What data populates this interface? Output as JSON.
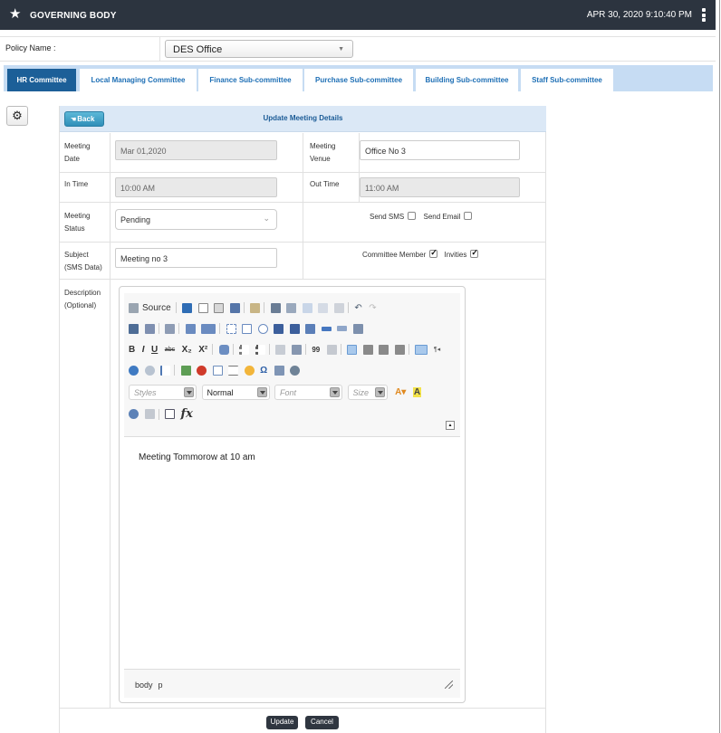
{
  "header": {
    "title": "GOVERNING BODY",
    "datetime": "APR 30, 2020  9:10:40 PM"
  },
  "policy": {
    "label": "Policy Name :",
    "selected": "DES Office"
  },
  "tabs": [
    {
      "label": "HR Committee",
      "active": true
    },
    {
      "label": "Local Managing Committee",
      "active": false
    },
    {
      "label": "Finance Sub-committee",
      "active": false
    },
    {
      "label": "Purchase Sub-committee",
      "active": false
    },
    {
      "label": "Building Sub-committee",
      "active": false
    },
    {
      "label": "Staff Sub-committee",
      "active": false
    }
  ],
  "form": {
    "back_label": "Back",
    "title": "Update Meeting Details",
    "meeting_date": {
      "label_line1": "Meeting",
      "label_line2": "Date",
      "value": "Mar 01,2020"
    },
    "meeting_venue": {
      "label_line1": "Meeting",
      "label_line2": "Venue",
      "value": "Office No 3"
    },
    "in_time": {
      "label": "In Time",
      "value": "10:00 AM"
    },
    "out_time": {
      "label": "Out Time",
      "value": "11:00 AM"
    },
    "meeting_status": {
      "label_line1": "Meeting",
      "label_line2": "Status",
      "value": "Pending"
    },
    "send_sms": {
      "label": "Send SMS",
      "checked": false
    },
    "send_email": {
      "label": "Send Email",
      "checked": false
    },
    "subject": {
      "label_line1": "Subject",
      "label_line2": "(SMS Data)",
      "value": "Meeting no 3"
    },
    "committee_member": {
      "label": "Committee Member",
      "checked": true
    },
    "invities": {
      "label": "Invities",
      "checked": true
    },
    "description": {
      "label_line1": "Description",
      "label_line2": "(Optional)"
    }
  },
  "editor": {
    "source_label": "Source",
    "styles_placeholder": "Styles",
    "format_value": "Normal",
    "font_placeholder": "Font",
    "size_placeholder": "Size",
    "fx_label": "fx",
    "bold_label": "B",
    "italic_label": "I",
    "underline_label": "U",
    "strike_label": "abc",
    "sub_label": "X₂",
    "sup_label": "X²",
    "content": "Meeting Tommorow at 10 am",
    "path": [
      "body",
      "p"
    ]
  },
  "actions": {
    "update_label": "Update",
    "cancel_label": "Cancel"
  },
  "colors": {
    "topbar": "#2c343f",
    "tab_active": "#1c5f98",
    "tab_text": "#1e6fb5",
    "tabs_bg": "#c6dcf3",
    "form_header": "#dbe8f6",
    "back_button": "#3aa0c8",
    "action_button": "#2f3640"
  }
}
